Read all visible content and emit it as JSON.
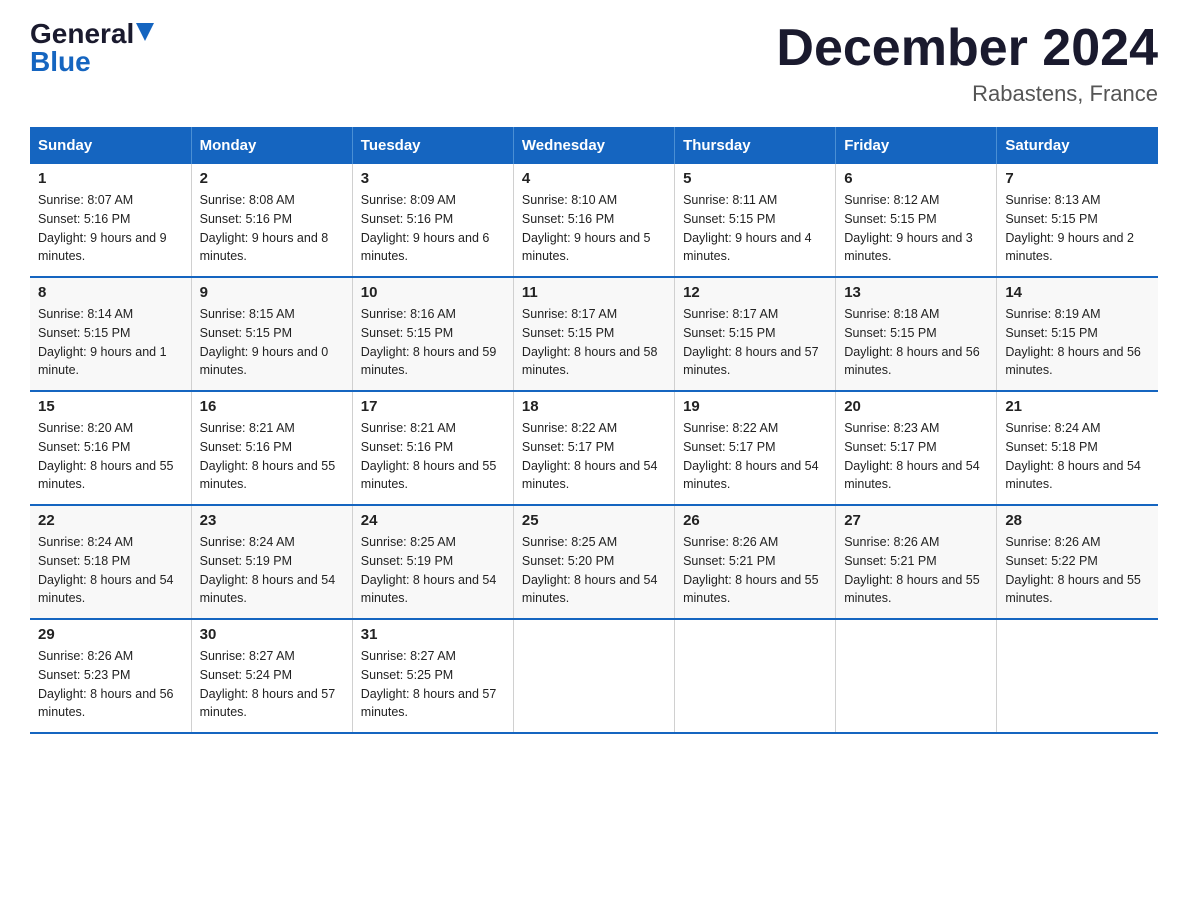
{
  "logo": {
    "general": "General",
    "blue": "Blue"
  },
  "title": {
    "month_year": "December 2024",
    "location": "Rabastens, France"
  },
  "headers": [
    "Sunday",
    "Monday",
    "Tuesday",
    "Wednesday",
    "Thursday",
    "Friday",
    "Saturday"
  ],
  "weeks": [
    [
      {
        "day": "1",
        "sunrise": "Sunrise: 8:07 AM",
        "sunset": "Sunset: 5:16 PM",
        "daylight": "Daylight: 9 hours and 9 minutes."
      },
      {
        "day": "2",
        "sunrise": "Sunrise: 8:08 AM",
        "sunset": "Sunset: 5:16 PM",
        "daylight": "Daylight: 9 hours and 8 minutes."
      },
      {
        "day": "3",
        "sunrise": "Sunrise: 8:09 AM",
        "sunset": "Sunset: 5:16 PM",
        "daylight": "Daylight: 9 hours and 6 minutes."
      },
      {
        "day": "4",
        "sunrise": "Sunrise: 8:10 AM",
        "sunset": "Sunset: 5:16 PM",
        "daylight": "Daylight: 9 hours and 5 minutes."
      },
      {
        "day": "5",
        "sunrise": "Sunrise: 8:11 AM",
        "sunset": "Sunset: 5:15 PM",
        "daylight": "Daylight: 9 hours and 4 minutes."
      },
      {
        "day": "6",
        "sunrise": "Sunrise: 8:12 AM",
        "sunset": "Sunset: 5:15 PM",
        "daylight": "Daylight: 9 hours and 3 minutes."
      },
      {
        "day": "7",
        "sunrise": "Sunrise: 8:13 AM",
        "sunset": "Sunset: 5:15 PM",
        "daylight": "Daylight: 9 hours and 2 minutes."
      }
    ],
    [
      {
        "day": "8",
        "sunrise": "Sunrise: 8:14 AM",
        "sunset": "Sunset: 5:15 PM",
        "daylight": "Daylight: 9 hours and 1 minute."
      },
      {
        "day": "9",
        "sunrise": "Sunrise: 8:15 AM",
        "sunset": "Sunset: 5:15 PM",
        "daylight": "Daylight: 9 hours and 0 minutes."
      },
      {
        "day": "10",
        "sunrise": "Sunrise: 8:16 AM",
        "sunset": "Sunset: 5:15 PM",
        "daylight": "Daylight: 8 hours and 59 minutes."
      },
      {
        "day": "11",
        "sunrise": "Sunrise: 8:17 AM",
        "sunset": "Sunset: 5:15 PM",
        "daylight": "Daylight: 8 hours and 58 minutes."
      },
      {
        "day": "12",
        "sunrise": "Sunrise: 8:17 AM",
        "sunset": "Sunset: 5:15 PM",
        "daylight": "Daylight: 8 hours and 57 minutes."
      },
      {
        "day": "13",
        "sunrise": "Sunrise: 8:18 AM",
        "sunset": "Sunset: 5:15 PM",
        "daylight": "Daylight: 8 hours and 56 minutes."
      },
      {
        "day": "14",
        "sunrise": "Sunrise: 8:19 AM",
        "sunset": "Sunset: 5:15 PM",
        "daylight": "Daylight: 8 hours and 56 minutes."
      }
    ],
    [
      {
        "day": "15",
        "sunrise": "Sunrise: 8:20 AM",
        "sunset": "Sunset: 5:16 PM",
        "daylight": "Daylight: 8 hours and 55 minutes."
      },
      {
        "day": "16",
        "sunrise": "Sunrise: 8:21 AM",
        "sunset": "Sunset: 5:16 PM",
        "daylight": "Daylight: 8 hours and 55 minutes."
      },
      {
        "day": "17",
        "sunrise": "Sunrise: 8:21 AM",
        "sunset": "Sunset: 5:16 PM",
        "daylight": "Daylight: 8 hours and 55 minutes."
      },
      {
        "day": "18",
        "sunrise": "Sunrise: 8:22 AM",
        "sunset": "Sunset: 5:17 PM",
        "daylight": "Daylight: 8 hours and 54 minutes."
      },
      {
        "day": "19",
        "sunrise": "Sunrise: 8:22 AM",
        "sunset": "Sunset: 5:17 PM",
        "daylight": "Daylight: 8 hours and 54 minutes."
      },
      {
        "day": "20",
        "sunrise": "Sunrise: 8:23 AM",
        "sunset": "Sunset: 5:17 PM",
        "daylight": "Daylight: 8 hours and 54 minutes."
      },
      {
        "day": "21",
        "sunrise": "Sunrise: 8:24 AM",
        "sunset": "Sunset: 5:18 PM",
        "daylight": "Daylight: 8 hours and 54 minutes."
      }
    ],
    [
      {
        "day": "22",
        "sunrise": "Sunrise: 8:24 AM",
        "sunset": "Sunset: 5:18 PM",
        "daylight": "Daylight: 8 hours and 54 minutes."
      },
      {
        "day": "23",
        "sunrise": "Sunrise: 8:24 AM",
        "sunset": "Sunset: 5:19 PM",
        "daylight": "Daylight: 8 hours and 54 minutes."
      },
      {
        "day": "24",
        "sunrise": "Sunrise: 8:25 AM",
        "sunset": "Sunset: 5:19 PM",
        "daylight": "Daylight: 8 hours and 54 minutes."
      },
      {
        "day": "25",
        "sunrise": "Sunrise: 8:25 AM",
        "sunset": "Sunset: 5:20 PM",
        "daylight": "Daylight: 8 hours and 54 minutes."
      },
      {
        "day": "26",
        "sunrise": "Sunrise: 8:26 AM",
        "sunset": "Sunset: 5:21 PM",
        "daylight": "Daylight: 8 hours and 55 minutes."
      },
      {
        "day": "27",
        "sunrise": "Sunrise: 8:26 AM",
        "sunset": "Sunset: 5:21 PM",
        "daylight": "Daylight: 8 hours and 55 minutes."
      },
      {
        "day": "28",
        "sunrise": "Sunrise: 8:26 AM",
        "sunset": "Sunset: 5:22 PM",
        "daylight": "Daylight: 8 hours and 55 minutes."
      }
    ],
    [
      {
        "day": "29",
        "sunrise": "Sunrise: 8:26 AM",
        "sunset": "Sunset: 5:23 PM",
        "daylight": "Daylight: 8 hours and 56 minutes."
      },
      {
        "day": "30",
        "sunrise": "Sunrise: 8:27 AM",
        "sunset": "Sunset: 5:24 PM",
        "daylight": "Daylight: 8 hours and 57 minutes."
      },
      {
        "day": "31",
        "sunrise": "Sunrise: 8:27 AM",
        "sunset": "Sunset: 5:25 PM",
        "daylight": "Daylight: 8 hours and 57 minutes."
      },
      null,
      null,
      null,
      null
    ]
  ]
}
